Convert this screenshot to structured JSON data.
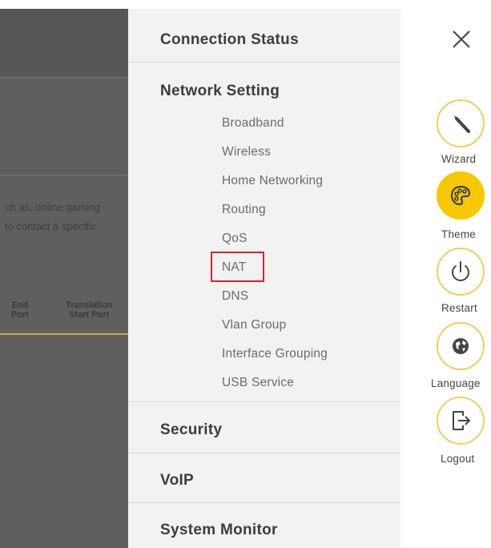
{
  "background": {
    "text_line1": "ch as, online gaming",
    "text_line2": "to contact a specific",
    "col_end": "End\nPort",
    "col_translation": "Translation\nStart Port"
  },
  "menu": {
    "connection_status": "Connection Status",
    "network_setting": "Network Setting",
    "sub_items": [
      "Broadband",
      "Wireless",
      "Home Networking",
      "Routing",
      "QoS",
      "NAT",
      "DNS",
      "Vlan Group",
      "Interface Grouping",
      "USB Service"
    ],
    "security": "Security",
    "voip": "VoIP",
    "system_monitor": "System Monitor",
    "highlighted_item": "NAT",
    "highlight_color": "#d9232f"
  },
  "shortcuts": {
    "wizard": {
      "label": "Wizard",
      "icon": "wizard-wand-icon"
    },
    "theme": {
      "label": "Theme",
      "icon": "palette-icon"
    },
    "restart": {
      "label": "Restart",
      "icon": "power-icon"
    },
    "language": {
      "label": "Language",
      "icon": "globe-icon"
    },
    "logout": {
      "label": "Logout",
      "icon": "logout-icon"
    },
    "accent_color": "#f5c800"
  },
  "close": {
    "icon": "close-icon"
  }
}
